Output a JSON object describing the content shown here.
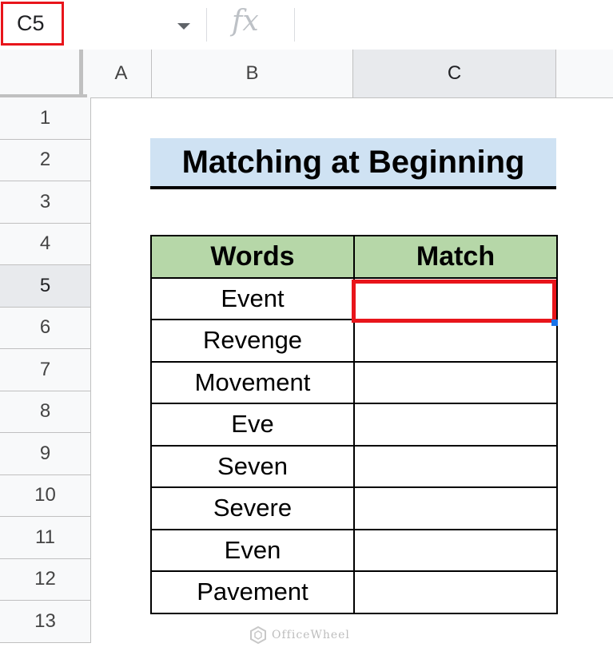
{
  "name_box": "C5",
  "formula_icon": "fx",
  "columns": [
    "A",
    "B",
    "C"
  ],
  "rows": [
    "1",
    "2",
    "3",
    "4",
    "5",
    "6",
    "7",
    "8",
    "9",
    "10",
    "11",
    "12",
    "13"
  ],
  "title": "Matching at Beginning",
  "table": {
    "headers": [
      "Words",
      "Match"
    ],
    "words": [
      "Event",
      "Revenge",
      "Movement",
      "Eve",
      "Seven",
      "Severe",
      "Even",
      "Pavement"
    ]
  },
  "watermark": "OfficeWheel",
  "colors": {
    "highlight": "#e8151b",
    "title_bg": "#cfe2f3",
    "header_bg": "#b6d7a8"
  }
}
